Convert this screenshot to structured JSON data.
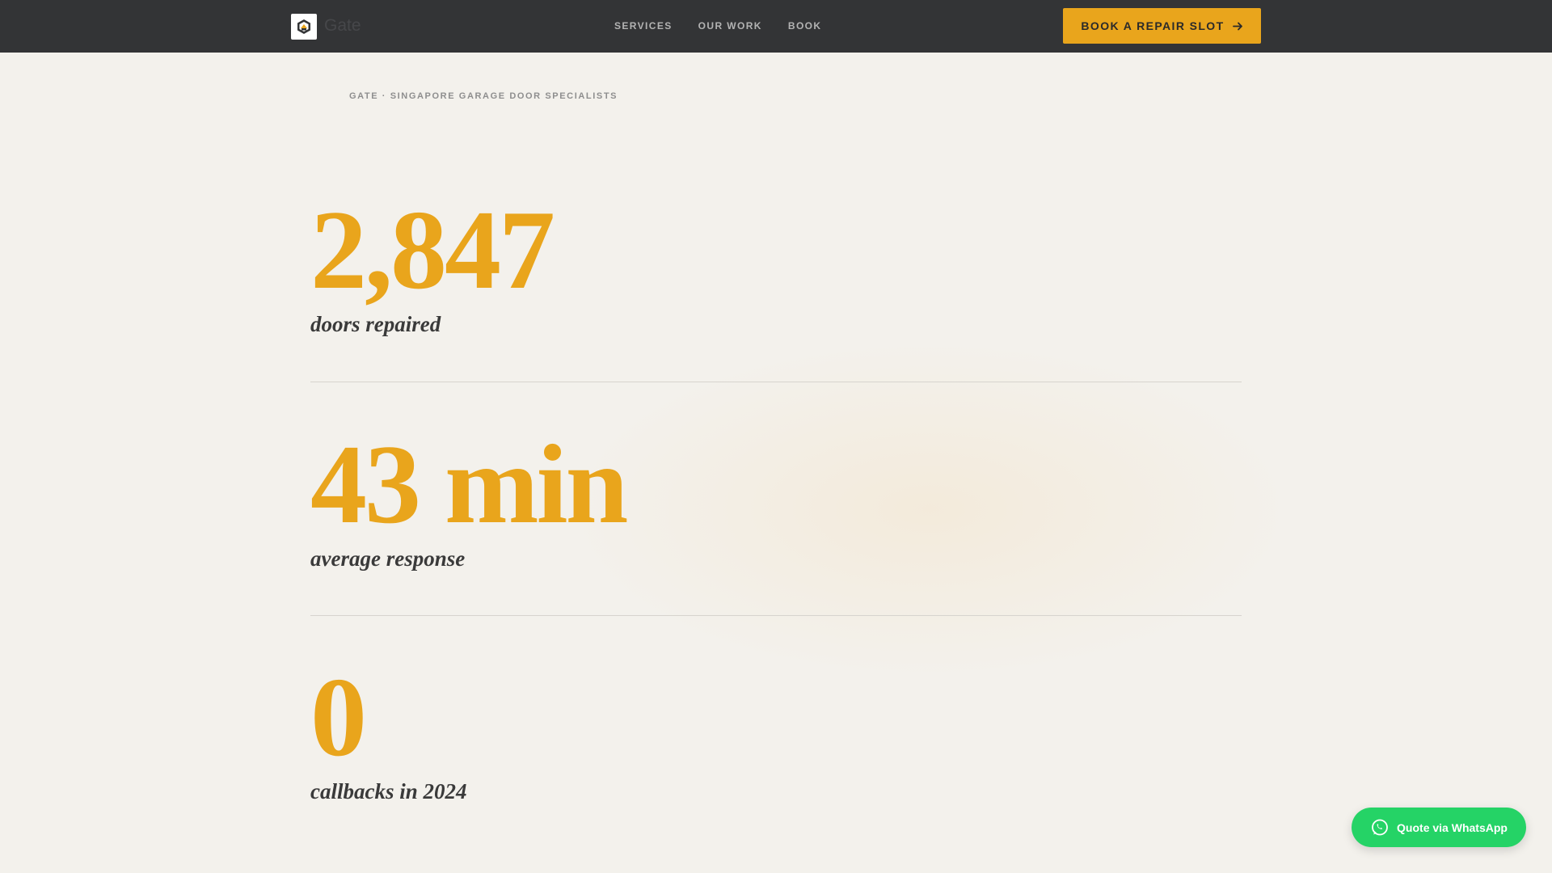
{
  "header": {
    "brand": "Gate",
    "nav": [
      "SERVICES",
      "OUR WORK",
      "BOOK"
    ],
    "cta_label": "BOOK A REPAIR SLOT",
    "background": "#333436"
  },
  "hero": {
    "eyebrow": "GATE · SINGAPORE GARAGE DOOR SPECIALISTS"
  },
  "stats": [
    {
      "value": "2,847",
      "label": "doors repaired"
    },
    {
      "value": "43 min",
      "label": "average response"
    },
    {
      "value": "0",
      "label": "callbacks in 2024"
    }
  ],
  "whatsapp": {
    "label": "Quote via WhatsApp",
    "color": "#25d366"
  },
  "colors": {
    "accent": "#e9a51c",
    "page_background": "#f3f1ec",
    "text_dark": "#3a3a3a"
  },
  "icons": {
    "logo": "gate-logo-icon",
    "cta": "arrow-right-icon",
    "whatsapp": "whatsapp-icon"
  }
}
